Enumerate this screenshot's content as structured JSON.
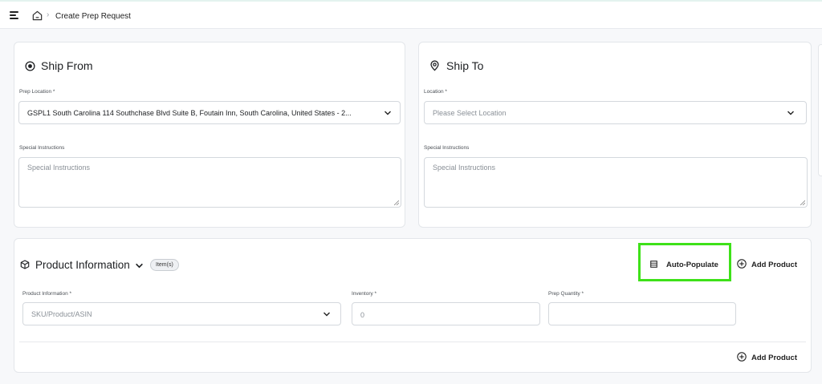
{
  "header": {
    "breadcrumb_title": "Create Prep Request"
  },
  "ship_from": {
    "title": "Ship From",
    "location_label": "Prep Location *",
    "location_value": "GSPL1 South Carolina 114 Southchase Blvd Suite B, Foutain Inn, South Carolina, United States - 2...",
    "instructions_label": "Special Instructions",
    "instructions_placeholder": "Special Instructions"
  },
  "ship_to": {
    "title": "Ship To",
    "location_label": "Location *",
    "location_placeholder": "Please Select Location",
    "instructions_label": "Special Instructions",
    "instructions_placeholder": "Special Instructions"
  },
  "product": {
    "title": "Product Information",
    "badge": "Item(s)",
    "auto_populate_label": "Auto-Populate",
    "add_product_label": "Add Product",
    "product_label": "Product Information *",
    "product_placeholder": "SKU/Product/ASIN",
    "inventory_label": "Inventory *",
    "inventory_value": "0",
    "prep_quantity_label": "Prep Quantity *",
    "prep_quantity_value": "",
    "add_product_bottom_label": "Add Product"
  },
  "colors": {
    "highlight": "#3ee119",
    "border": "#d4d8dd",
    "text": "#1d1f22"
  },
  "icons": [
    "menu-icon",
    "home-icon",
    "radio-target-icon",
    "map-pin-icon",
    "cube-icon",
    "chevron-down-icon",
    "spreadsheet-icon",
    "plus-circle-icon"
  ]
}
